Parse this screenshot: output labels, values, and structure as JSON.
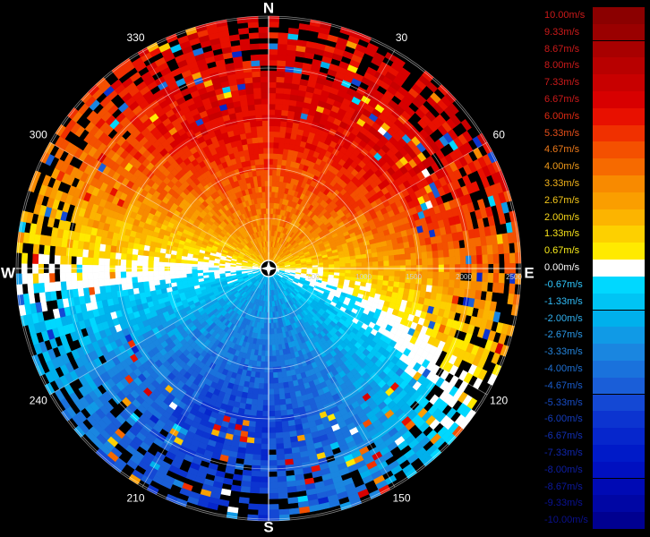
{
  "chart_data": {
    "type": "radial-velocity-ppi",
    "cardinals": [
      "N",
      "E",
      "S",
      "W"
    ],
    "bearing_labels": [
      "30",
      "60",
      "120",
      "150",
      "210",
      "240",
      "300",
      "330"
    ],
    "range_labels": [
      "500",
      "1000",
      "1500",
      "2000",
      "2500"
    ],
    "legend": {
      "labels": [
        "10.00m/s",
        "9.33m/s",
        "8.67m/s",
        "8.00m/s",
        "7.33m/s",
        "6.67m/s",
        "6.00m/s",
        "5.33m/s",
        "4.67m/s",
        "4.00m/s",
        "3.33m/s",
        "2.67m/s",
        "2.00m/s",
        "1.33m/s",
        "0.67m/s",
        "0.00m/s",
        "-0.67m/s",
        "-1.33m/s",
        "-2.00m/s",
        "-2.67m/s",
        "-3.33m/s",
        "-4.00m/s",
        "-4.67m/s",
        "-5.33m/s",
        "-6.00m/s",
        "-6.67m/s",
        "-7.33m/s",
        "-8.00m/s",
        "-8.67m/s",
        "-9.33m/s",
        "-10.00m/s"
      ],
      "values": [
        10.0,
        9.33,
        8.67,
        8.0,
        7.33,
        6.67,
        6.0,
        5.33,
        4.67,
        4.0,
        3.33,
        2.67,
        2.0,
        1.33,
        0.67,
        0.0,
        -0.67,
        -1.33,
        -2.0,
        -2.67,
        -3.33,
        -4.0,
        -4.67,
        -5.33,
        -6.0,
        -6.67,
        -7.33,
        -8.0,
        -8.67,
        -9.33,
        -10.0
      ],
      "colors": [
        "#8b0000",
        "#9a0000",
        "#a80000",
        "#b80000",
        "#c80000",
        "#d80000",
        "#e81000",
        "#f03000",
        "#f45000",
        "#f66a00",
        "#f88a00",
        "#fa9e00",
        "#fcb400",
        "#fdd000",
        "#ffea00",
        "#ffffff",
        "#00d8ff",
        "#00c4f4",
        "#00b0ec",
        "#109ae6",
        "#1a86e0",
        "#1a72dc",
        "#1a5ed8",
        "#1448d4",
        "#0c34d0",
        "#0626cc",
        "#001ac8",
        "#0010c0",
        "#000ab4",
        "#0006a4",
        "#000090"
      ],
      "label_colors": [
        "#cc1a1a",
        "#cc1a1a",
        "#cc1a1a",
        "#cc1a1a",
        "#cc1a1a",
        "#cc1a1a",
        "#e02a12",
        "#e8501a",
        "#ee7a1a",
        "#f09a1a",
        "#f4b41a",
        "#f6c81a",
        "#f8d81a",
        "#fae41a",
        "#fcee1a",
        "#ffffff",
        "#30c8ff",
        "#30bcf8",
        "#30b0f0",
        "#2a98e8",
        "#2484dc",
        "#1e70d4",
        "#1a5ccc",
        "#184cc4",
        "#143cbc",
        "#1230b4",
        "#1026ac",
        "#0e1ea4",
        "#0c189c",
        "#0a1294",
        "#0a108c"
      ]
    }
  }
}
